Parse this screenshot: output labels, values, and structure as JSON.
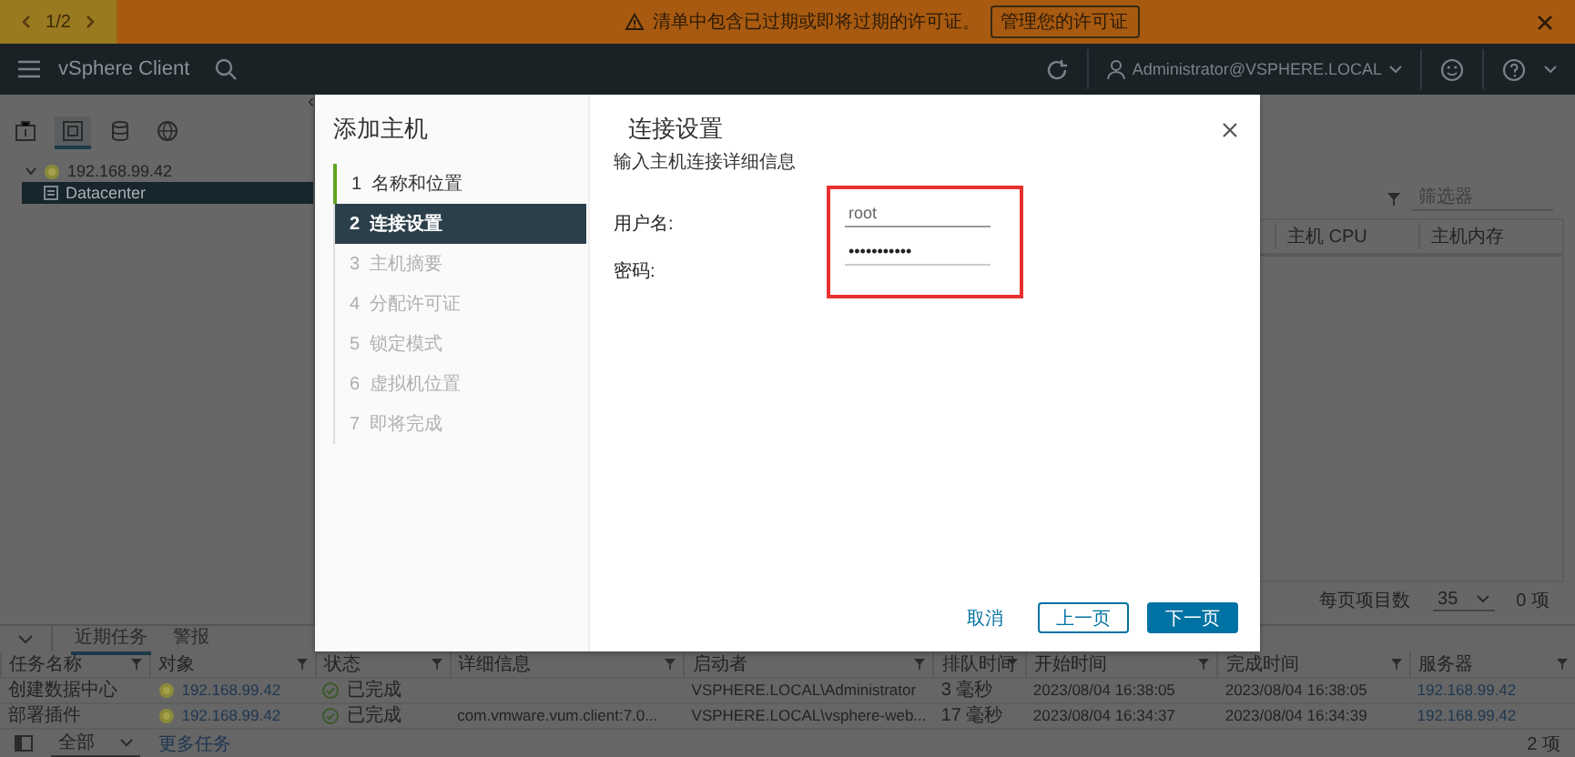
{
  "banner": {
    "pager": "1/2",
    "message": "清单中包含已过期或即将过期的许可证。",
    "action": "管理您的许可证"
  },
  "header": {
    "app_name": "vSphere Client",
    "user": "Administrator@VSPHERE.LOCAL"
  },
  "navigator": {
    "tabs": [
      {
        "kind": "hosts",
        "selected": false
      },
      {
        "kind": "vms",
        "selected": true
      },
      {
        "kind": "storage",
        "selected": false
      },
      {
        "kind": "network",
        "selected": false
      }
    ],
    "tree": [
      {
        "label": "192.168.99.42",
        "expanded": true,
        "selected": false,
        "children": [
          {
            "label": "Datacenter",
            "selected": true
          }
        ]
      }
    ]
  },
  "content": {
    "collapse": "‹",
    "filter_placeholder": "筛选器",
    "columns": [
      "主机 CPU",
      "主机内存"
    ],
    "page_size_label": "每页项目数",
    "page_size": "35",
    "count": "0 项"
  },
  "tasks": {
    "tabs": [
      {
        "label": "近期任务",
        "selected": true
      },
      {
        "label": "警报",
        "selected": false
      }
    ],
    "columns": [
      "任务名称",
      "对象",
      "状态",
      "详细信息",
      "启动者",
      "排队时间",
      "开始时间",
      "完成时间",
      "服务器"
    ],
    "rows": [
      {
        "name": "创建数据中心",
        "object": "192.168.99.42",
        "status": "已完成",
        "details": "",
        "initiator": "VSPHERE.LOCAL\\Administrator",
        "queued": "3 毫秒",
        "start": "2023/08/04 16:38:05",
        "end": "2023/08/04 16:38:05",
        "server": "192.168.99.42"
      },
      {
        "name": "部署插件",
        "object": "192.168.99.42",
        "status": "已完成",
        "details": "com.vmware.vum.client:7.0...",
        "initiator": "VSPHERE.LOCAL\\vsphere-web...",
        "queued": "17 毫秒",
        "start": "2023/08/04 16:34:37",
        "end": "2023/08/04 16:34:39",
        "server": "192.168.99.42"
      }
    ],
    "filter": "全部",
    "more": "更多任务",
    "count": "2 项"
  },
  "dialog": {
    "title": "添加主机",
    "steps": [
      {
        "number": "1",
        "label": "名称和位置",
        "done": true,
        "selected": false,
        "disabled": false
      },
      {
        "number": "2",
        "label": "连接设置",
        "done": false,
        "selected": true,
        "disabled": false
      },
      {
        "number": "3",
        "label": "主机摘要",
        "done": false,
        "selected": false,
        "disabled": true
      },
      {
        "number": "4",
        "label": "分配许可证",
        "done": false,
        "selected": false,
        "disabled": true
      },
      {
        "number": "5",
        "label": "锁定模式",
        "done": false,
        "selected": false,
        "disabled": true
      },
      {
        "number": "6",
        "label": "虚拟机位置",
        "done": false,
        "selected": false,
        "disabled": true
      },
      {
        "number": "7",
        "label": "即将完成",
        "done": false,
        "selected": false,
        "disabled": true
      }
    ],
    "heading": "连接设置",
    "subtitle": "输入主机连接详细信息",
    "highlighted": true,
    "fields": [
      {
        "label": "用户名:",
        "value": "root",
        "kind": "text"
      },
      {
        "label": "密码:",
        "value": "•••••••••••",
        "kind": "password"
      }
    ],
    "buttons": [
      {
        "label": "取消",
        "kind": "link"
      },
      {
        "label": "上一页",
        "kind": "secondary"
      },
      {
        "label": "下一页",
        "kind": "primary"
      }
    ]
  }
}
